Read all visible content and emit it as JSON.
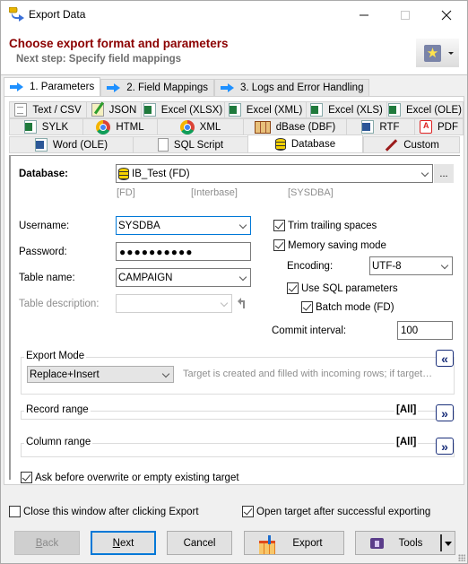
{
  "window": {
    "title": "Export Data",
    "minimize_icon": "minimize-icon",
    "maximize_icon": "maximize-icon",
    "close_icon": "close-icon"
  },
  "header": {
    "title": "Choose export format and parameters",
    "subtitle": "Next step: Specify field mappings",
    "favorites_icon": "star-icon",
    "colors": {
      "title": "#8b0000",
      "subtitle": "#6f6f6f"
    }
  },
  "main_tabs": [
    {
      "label": "1. Parameters",
      "active": true
    },
    {
      "label": "2. Field Mappings",
      "active": false
    },
    {
      "label": "3. Logs and Error Handling",
      "active": false
    }
  ],
  "format_tabs": {
    "row1": [
      {
        "label": "Text / CSV",
        "icon": "text-file-icon"
      },
      {
        "label": "JSON",
        "icon": "json-icon"
      },
      {
        "label": "Excel (XLSX)",
        "icon": "excel-icon"
      },
      {
        "label": "Excel (XML)",
        "icon": "excel-icon"
      },
      {
        "label": "Excel (XLS)",
        "icon": "excel-icon"
      },
      {
        "label": "Excel (OLE)",
        "icon": "excel-icon"
      }
    ],
    "row2": [
      {
        "label": "SYLK",
        "icon": "sylk-icon"
      },
      {
        "label": "HTML",
        "icon": "chrome-icon"
      },
      {
        "label": "XML",
        "icon": "chrome-icon"
      },
      {
        "label": "dBase (DBF)",
        "icon": "dbf-icon"
      },
      {
        "label": "RTF",
        "icon": "word-icon"
      },
      {
        "label": "PDF",
        "icon": "pdf-icon"
      }
    ],
    "row3": [
      {
        "label": "Word (OLE)",
        "icon": "word-icon"
      },
      {
        "label": "SQL Script",
        "icon": "sql-file-icon"
      },
      {
        "label": "Database",
        "icon": "database-icon",
        "active": true
      },
      {
        "label": "Custom",
        "icon": "pen-icon"
      }
    ]
  },
  "database": {
    "label": "Database:",
    "value": "IB_Test (FD)",
    "browse_label": "...",
    "info": [
      "[FD]",
      "[Interbase]",
      "[SYSDBA]"
    ]
  },
  "form": {
    "username_label": "Username:",
    "username_value": "SYSDBA",
    "password_label": "Password:",
    "password_value": "●●●●●●●●●●",
    "table_name_label": "Table name:",
    "table_name_value": "CAMPAIGN",
    "table_description_label": "Table description:",
    "table_description_value": ""
  },
  "options": {
    "trim_trailing_spaces": {
      "label": "Trim trailing spaces",
      "checked": true
    },
    "memory_saving_mode": {
      "label": "Memory saving mode",
      "checked": true
    },
    "encoding_label": "Encoding:",
    "encoding_value": "UTF-8",
    "use_sql_parameters": {
      "label": "Use SQL parameters",
      "checked": true
    },
    "batch_mode": {
      "label": "Batch mode (FD)",
      "checked": true
    },
    "commit_interval_label": "Commit interval:",
    "commit_interval_value": "100"
  },
  "export_mode": {
    "title": "Export Mode",
    "value": "Replace+Insert",
    "description": "Target is created and filled with incoming rows; if target…",
    "collapse_label": "«"
  },
  "record_range": {
    "title": "Record range",
    "value": "[All]",
    "expand_label": "»"
  },
  "column_range": {
    "title": "Column range",
    "value": "[All]",
    "expand_label": "»"
  },
  "ask_before_overwrite": {
    "label": "Ask before overwrite or empty existing target",
    "checked": true
  },
  "footer": {
    "close_after_export": {
      "label": "Close this window after clicking Export",
      "checked": false
    },
    "open_target_after": {
      "label": "Open target after successful exporting",
      "checked": true
    },
    "buttons": {
      "back": "Back",
      "next": "Next",
      "cancel": "Cancel",
      "export": "Export",
      "tools": "Tools"
    }
  }
}
